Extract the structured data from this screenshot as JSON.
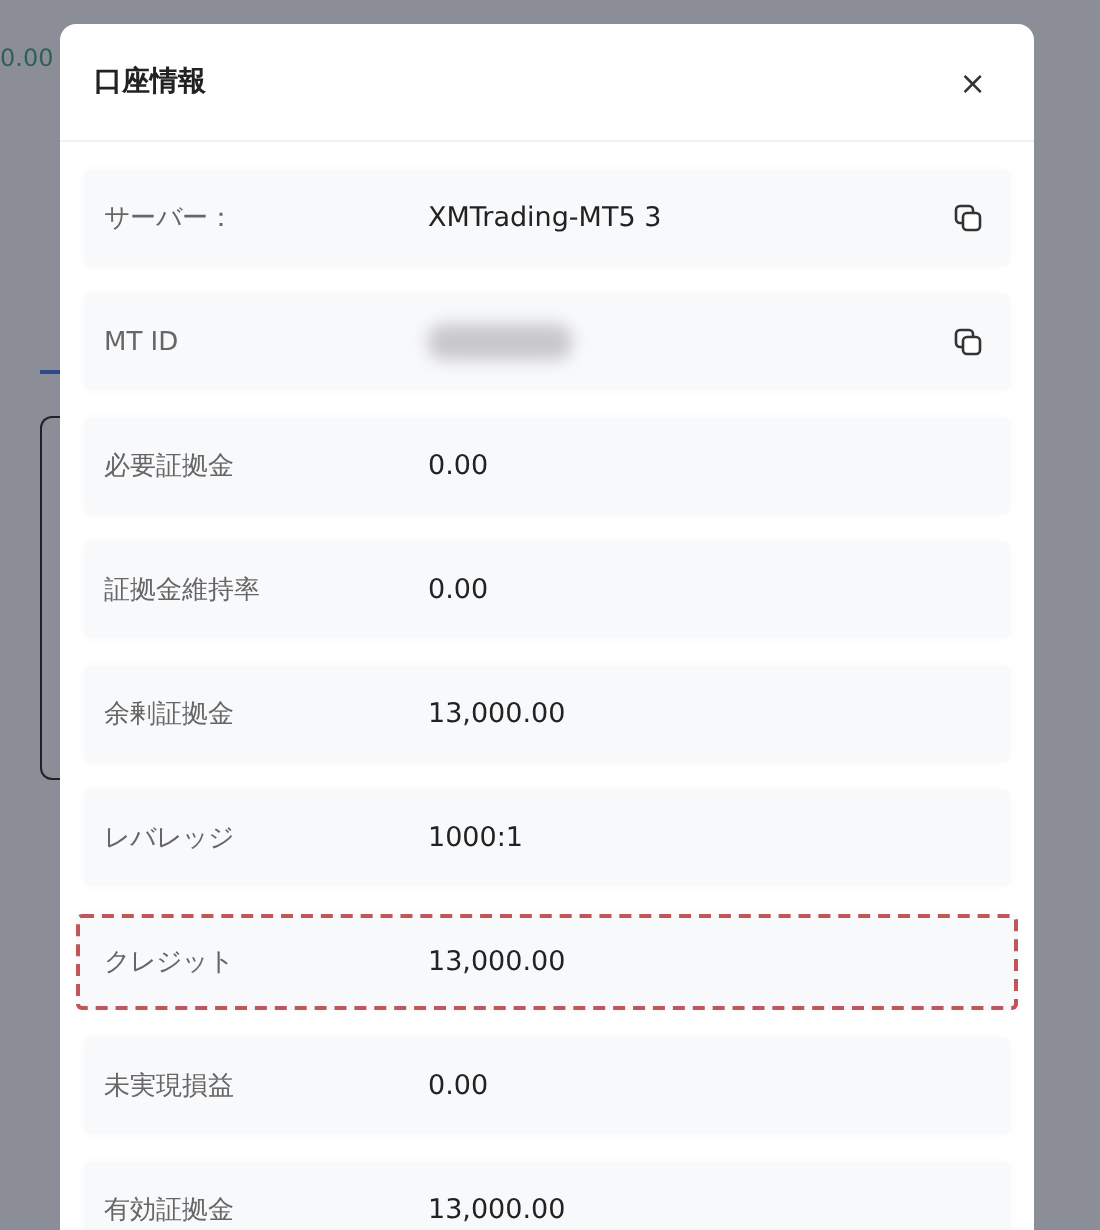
{
  "background": {
    "balance": "0.00"
  },
  "dialog": {
    "title": "口座情報",
    "close": "×",
    "rows": [
      {
        "label": "サーバー：",
        "value": "XMTrading-MT5 3",
        "copyable": true,
        "redacted": false,
        "highlighted": false
      },
      {
        "label": "MT ID",
        "value": "",
        "copyable": true,
        "redacted": true,
        "highlighted": false
      },
      {
        "label": "必要証拠金",
        "value": "0.00",
        "copyable": false,
        "redacted": false,
        "highlighted": false
      },
      {
        "label": "証拠金維持率",
        "value": "0.00",
        "copyable": false,
        "redacted": false,
        "highlighted": false
      },
      {
        "label": "余剰証拠金",
        "value": "13,000.00",
        "copyable": false,
        "redacted": false,
        "highlighted": false
      },
      {
        "label": "レバレッジ",
        "value": "1000:1",
        "copyable": false,
        "redacted": false,
        "highlighted": false
      },
      {
        "label": "クレジット",
        "value": "13,000.00",
        "copyable": false,
        "redacted": false,
        "highlighted": true
      },
      {
        "label": "未実現損益",
        "value": "0.00",
        "copyable": false,
        "redacted": false,
        "highlighted": false
      },
      {
        "label": "有効証拠金",
        "value": "13,000.00",
        "copyable": false,
        "redacted": false,
        "highlighted": false
      }
    ]
  }
}
